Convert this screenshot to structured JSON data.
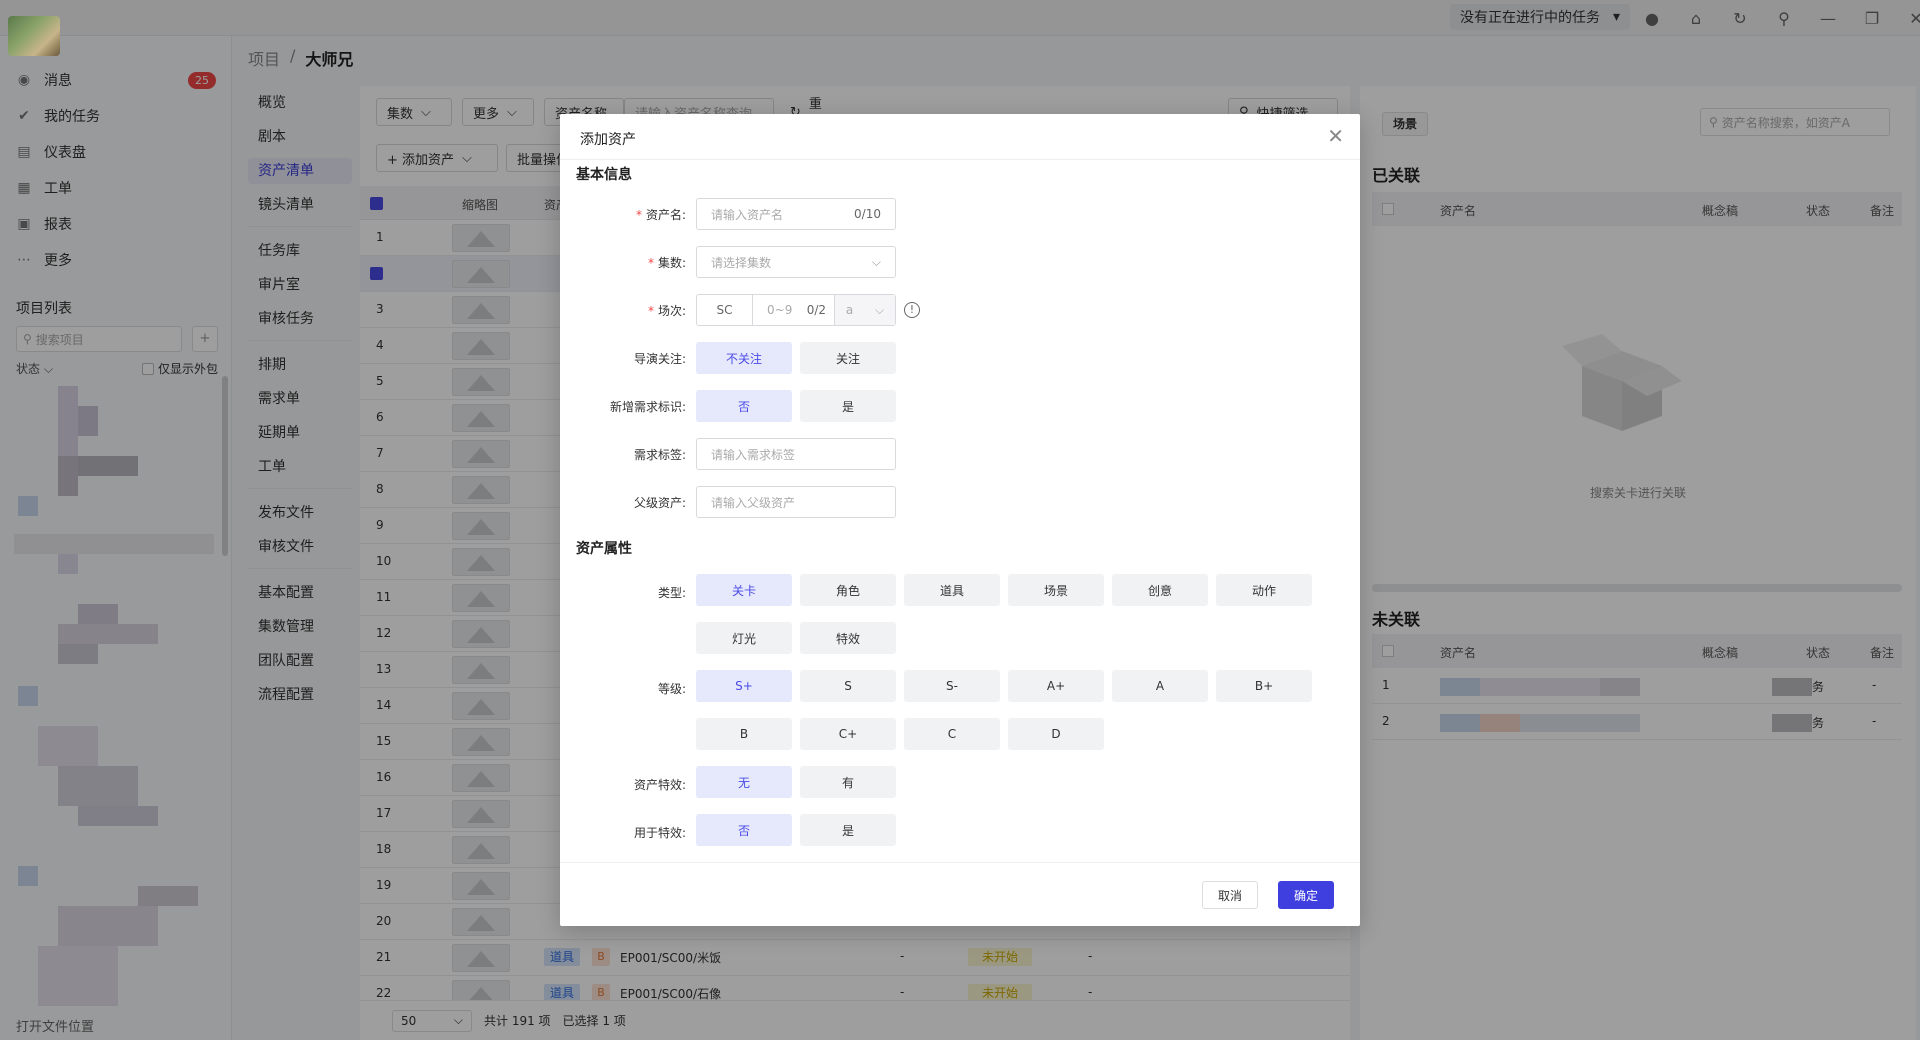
{
  "topbar": {
    "task_select": "没有正在进行中的任务",
    "icons": [
      "info-icon",
      "bug-icon",
      "refresh-icon",
      "pin-icon",
      "minimize-icon",
      "restore-icon",
      "close-icon"
    ]
  },
  "sidebar": {
    "items": [
      {
        "label": "消息",
        "icon": "message-icon"
      },
      {
        "label": "我的任务",
        "icon": "check-icon"
      },
      {
        "label": "仪表盘",
        "icon": "dashboard-icon"
      },
      {
        "label": "工单",
        "icon": "ticket-icon"
      },
      {
        "label": "报表",
        "icon": "report-icon"
      },
      {
        "label": "更多",
        "icon": "more-icon"
      }
    ],
    "badge": "25",
    "project_list_title": "项目列表",
    "search_placeholder": "搜索项目",
    "state_label": "状态",
    "show_external": "仅显示外包",
    "bottom": "打开文件位置"
  },
  "breadcrumb": {
    "parent": "项目",
    "sep": "/",
    "current": "大师兄"
  },
  "subnav": [
    "概览",
    "剧本",
    "资产清单",
    "镜头清单",
    "任务库",
    "审片室",
    "审核任务",
    "排期",
    "需求单",
    "延期单",
    "工单",
    "发布文件",
    "审核文件",
    "基本配置",
    "集数管理",
    "团队配置",
    "流程配置"
  ],
  "main": {
    "toolbar": {
      "episodes": "集数",
      "more": "更多",
      "field": "资产名称",
      "search_placeholder": "请输入资产名称查询",
      "reset": "重置",
      "quick_filter": "快捷筛选",
      "add_asset": "+ 添加资产",
      "batch": "批量操作"
    },
    "columns": {
      "thumb": "缩略图",
      "asset": "资产名"
    },
    "rows": [
      "1",
      "2",
      "3",
      "4",
      "5",
      "6",
      "7",
      "8",
      "9",
      "10",
      "11",
      "12",
      "13",
      "14",
      "15",
      "16",
      "17",
      "18",
      "19",
      "20",
      "21",
      "22"
    ],
    "row_samples": [
      {
        "type": "道具",
        "level": "B",
        "name": "EP001/SC00/米饭",
        "dash": "-",
        "status": "未开始",
        "dash2": "-"
      },
      {
        "type": "道具",
        "level": "B",
        "name": "EP001/SC00/石像",
        "dash": "-",
        "status": "未开始",
        "dash2": "-"
      }
    ],
    "footer": {
      "page_size": "50",
      "total": "共计 191 项",
      "selected": "已选择 1 项"
    }
  },
  "right_panel": {
    "scene_btn": "场景",
    "search_placeholder": "资产名称搜索，如资产A",
    "linked_title": "已关联",
    "unlinked_title": "未关联",
    "columns": {
      "name": "资产名",
      "concept": "概念稿",
      "status": "状态",
      "note": "备注"
    },
    "empty_text": "搜索关卡进行关联",
    "unlinked_rows": [
      {
        "idx": "1",
        "status": "务",
        "note": "-"
      },
      {
        "idx": "2",
        "status": "务",
        "note": "-"
      }
    ]
  },
  "modal": {
    "title": "添加资产",
    "basic_section": "基本信息",
    "fields": {
      "name_label": "资产名:",
      "name_placeholder": "请输入资产名",
      "name_count": "0/10",
      "episode_label": "集数:",
      "episode_placeholder": "请选择集数",
      "scene_label": "场次:",
      "scene_prefix": "SC",
      "scene_placeholder": "0~9",
      "scene_count": "0/2",
      "scene_suffix": "a",
      "director_label": "导演关注:",
      "director_opts": [
        "不关注",
        "关注"
      ],
      "new_req_label": "新增需求标识:",
      "new_req_opts": [
        "否",
        "是"
      ],
      "req_tag_label": "需求标签:",
      "req_tag_placeholder": "请输入需求标签",
      "parent_label": "父级资产:",
      "parent_placeholder": "请输入父级资产"
    },
    "attr_section": "资产属性",
    "attrs": {
      "type_label": "类型:",
      "types": [
        "关卡",
        "角色",
        "道具",
        "场景",
        "创意",
        "动作",
        "灯光",
        "特效"
      ],
      "level_label": "等级:",
      "levels": [
        "S+",
        "S",
        "S-",
        "A+",
        "A",
        "B+",
        "B",
        "C+",
        "C",
        "D"
      ],
      "fx_label": "资产特效:",
      "fx_opts": [
        "无",
        "有"
      ],
      "forfx_label": "用于特效:",
      "forfx_opts": [
        "否",
        "是"
      ]
    },
    "cancel": "取消",
    "ok": "确定"
  }
}
